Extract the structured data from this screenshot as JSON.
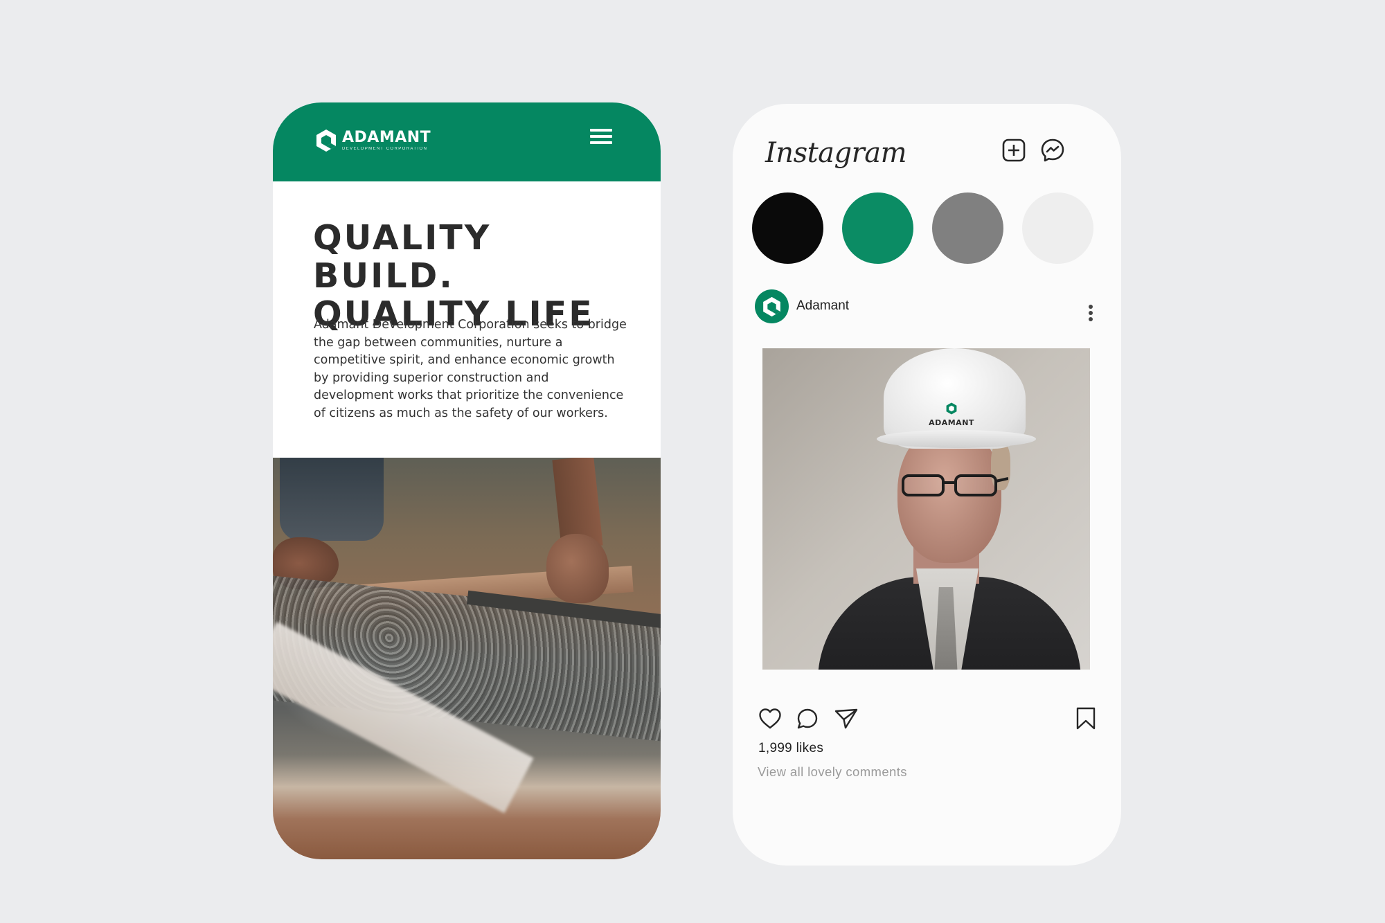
{
  "website": {
    "logo": {
      "name": "ADAMANT",
      "tagline": "DEVELOPMENT CORPORATION"
    },
    "headline": {
      "line1": "QUALITY BUILD.",
      "line2": "QUALITY LIFE"
    },
    "paragraph": "Adamant Development Corporation seeks to bridge the gap between communities, nurture a competitive spirit, and enhance economic growth by providing superior construction and development works that prioritize the convenience of citizens as much as the safety of our workers.",
    "icons": {
      "menu": "hamburger-menu-icon",
      "logo": "adamant-hexagon-logo"
    }
  },
  "instagram": {
    "wordmark": "Instagram",
    "header_icons": [
      "new-post-icon",
      "messenger-icon"
    ],
    "stories": [
      {
        "color": "#0a0a0a"
      },
      {
        "color": "#0b8c64"
      },
      {
        "color": "#808080"
      },
      {
        "color": "#eeeeee"
      }
    ],
    "post": {
      "username": "Adamant",
      "helmet_text": "ADAMANT",
      "likes": "1,999 likes",
      "comments_link": "View all lovely comments",
      "action_icons": [
        "heart-icon",
        "comment-icon",
        "share-icon",
        "bookmark-icon"
      ]
    }
  },
  "colors": {
    "brand_green": "#058761",
    "background": "#ebecee",
    "text_dark": "#2b2b2b",
    "text_muted": "#9a9a9a"
  }
}
